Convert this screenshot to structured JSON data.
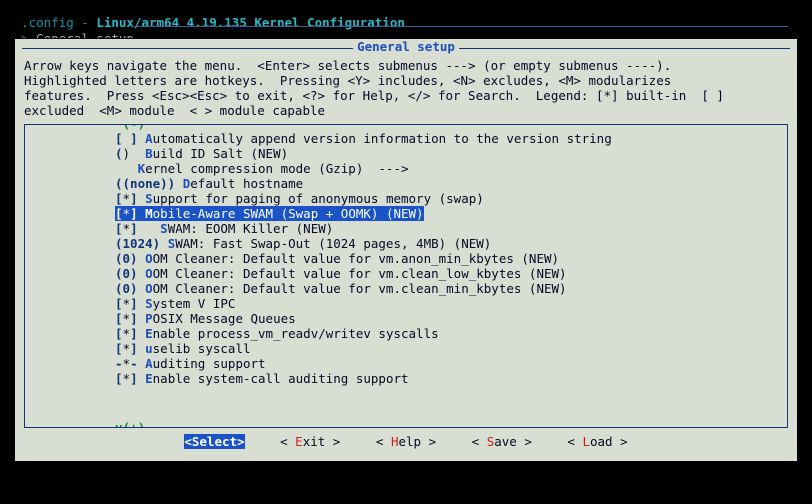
{
  "header": {
    "config_label": ".config",
    "kernel": "Linux/arm64 4.19.135 Kernel Configuration",
    "sep": " - "
  },
  "breadcrumb": {
    "indicator": ">",
    "path": "General setup"
  },
  "frame": {
    "title": "General setup",
    "scroll_up": "^(-)",
    "scroll_dn": "v(+)"
  },
  "helptext": {
    "line1_a": "Arrow keys navigate the menu.  ",
    "line1_b": "<Enter>",
    "line1_c": " selects submenus ---> (or empty submenus ----).",
    "line2_a": "Highlighted letters are hotkeys.  Pressing ",
    "line2_b": "<Y>",
    "line2_c": " includes, ",
    "line2_d": "<N>",
    "line2_e": " excludes, ",
    "line2_f": "<M>",
    "line2_g": " modularizes",
    "line3_a": "features.  Press ",
    "line3_b": "<Esc><Esc>",
    "line3_c": " to exit, ",
    "line3_d": "<?>",
    "line3_e": " for Help, ",
    "line3_f": "</>",
    "line3_g": " for Search.  Legend: ",
    "line3_h": "[*]",
    "line3_i": " built-in  [ ]",
    "line4_a": "excluded  ",
    "line4_b": "<M>",
    "line4_c": " module  < > module capable"
  },
  "menu": {
    "rows": [
      {
        "state": "[ ]",
        "hot": "A",
        "text": "utomatically append version information to the version string",
        "sel": false
      },
      {
        "state": "() ",
        "hot": "B",
        "text": "uild ID Salt (NEW)",
        "sel": false
      },
      {
        "state": "   ",
        "hot": "K",
        "text": "ernel compression mode (Gzip)  --->",
        "sel": false
      },
      {
        "state": "((none)) ",
        "hot": "D",
        "text": "efault hostname",
        "sel": false,
        "raw": true
      },
      {
        "state": "[*]",
        "hot": "S",
        "text": "upport for paging of anonymous memory (swap)",
        "sel": false
      },
      {
        "state": "[*]",
        "hot": "M",
        "text": "obile-Aware SWAM (Swap + OOMK) (NEW)",
        "sel": true
      },
      {
        "state": "[*]",
        "hot": "  S",
        "text": "WAM: EOOM Killer (NEW)",
        "sel": false
      },
      {
        "state": "(1024) ",
        "hot": "S",
        "text": "WAM: Fast Swap-Out (1024 pages, 4MB) (NEW)",
        "sel": false,
        "raw": true
      },
      {
        "state": "(0) ",
        "hot": "O",
        "text": "OM Cleaner: Default value for vm.anon_min_kbytes (NEW)",
        "sel": false,
        "raw": true
      },
      {
        "state": "(0) ",
        "hot": "O",
        "text": "OM Cleaner: Default value for vm.clean_low_kbytes (NEW)",
        "sel": false,
        "raw": true
      },
      {
        "state": "(0) ",
        "hot": "O",
        "text": "OM Cleaner: Default value for vm.clean_min_kbytes (NEW)",
        "sel": false,
        "raw": true
      },
      {
        "state": "[*]",
        "hot": "S",
        "text": "ystem V IPC",
        "sel": false
      },
      {
        "state": "[*]",
        "hot": "P",
        "text": "OSIX Message Queues",
        "sel": false
      },
      {
        "state": "[*]",
        "hot": "E",
        "text": "nable process_vm_readv/writev syscalls",
        "sel": false
      },
      {
        "state": "[*]",
        "hot": "u",
        "text": "selib syscall",
        "sel": false
      },
      {
        "state": "-*-",
        "hot": "A",
        "text": "uditing support",
        "sel": false
      },
      {
        "state": "[*]",
        "hot": "E",
        "text": "nable system-call auditing support",
        "sel": false
      }
    ]
  },
  "buttons": {
    "select": {
      "left": "<",
      "right": ">",
      "hot": "S",
      "rest": "elect"
    },
    "exit": {
      "left": "< ",
      "right": " >",
      "hot": "E",
      "rest": "xit"
    },
    "help": {
      "left": "< ",
      "right": " >",
      "hot": "H",
      "rest": "elp"
    },
    "save": {
      "left": "< ",
      "right": " >",
      "hot": "S",
      "rest": "ave"
    },
    "load": {
      "left": "< ",
      "right": " >",
      "hot": "L",
      "rest": "oad"
    }
  }
}
